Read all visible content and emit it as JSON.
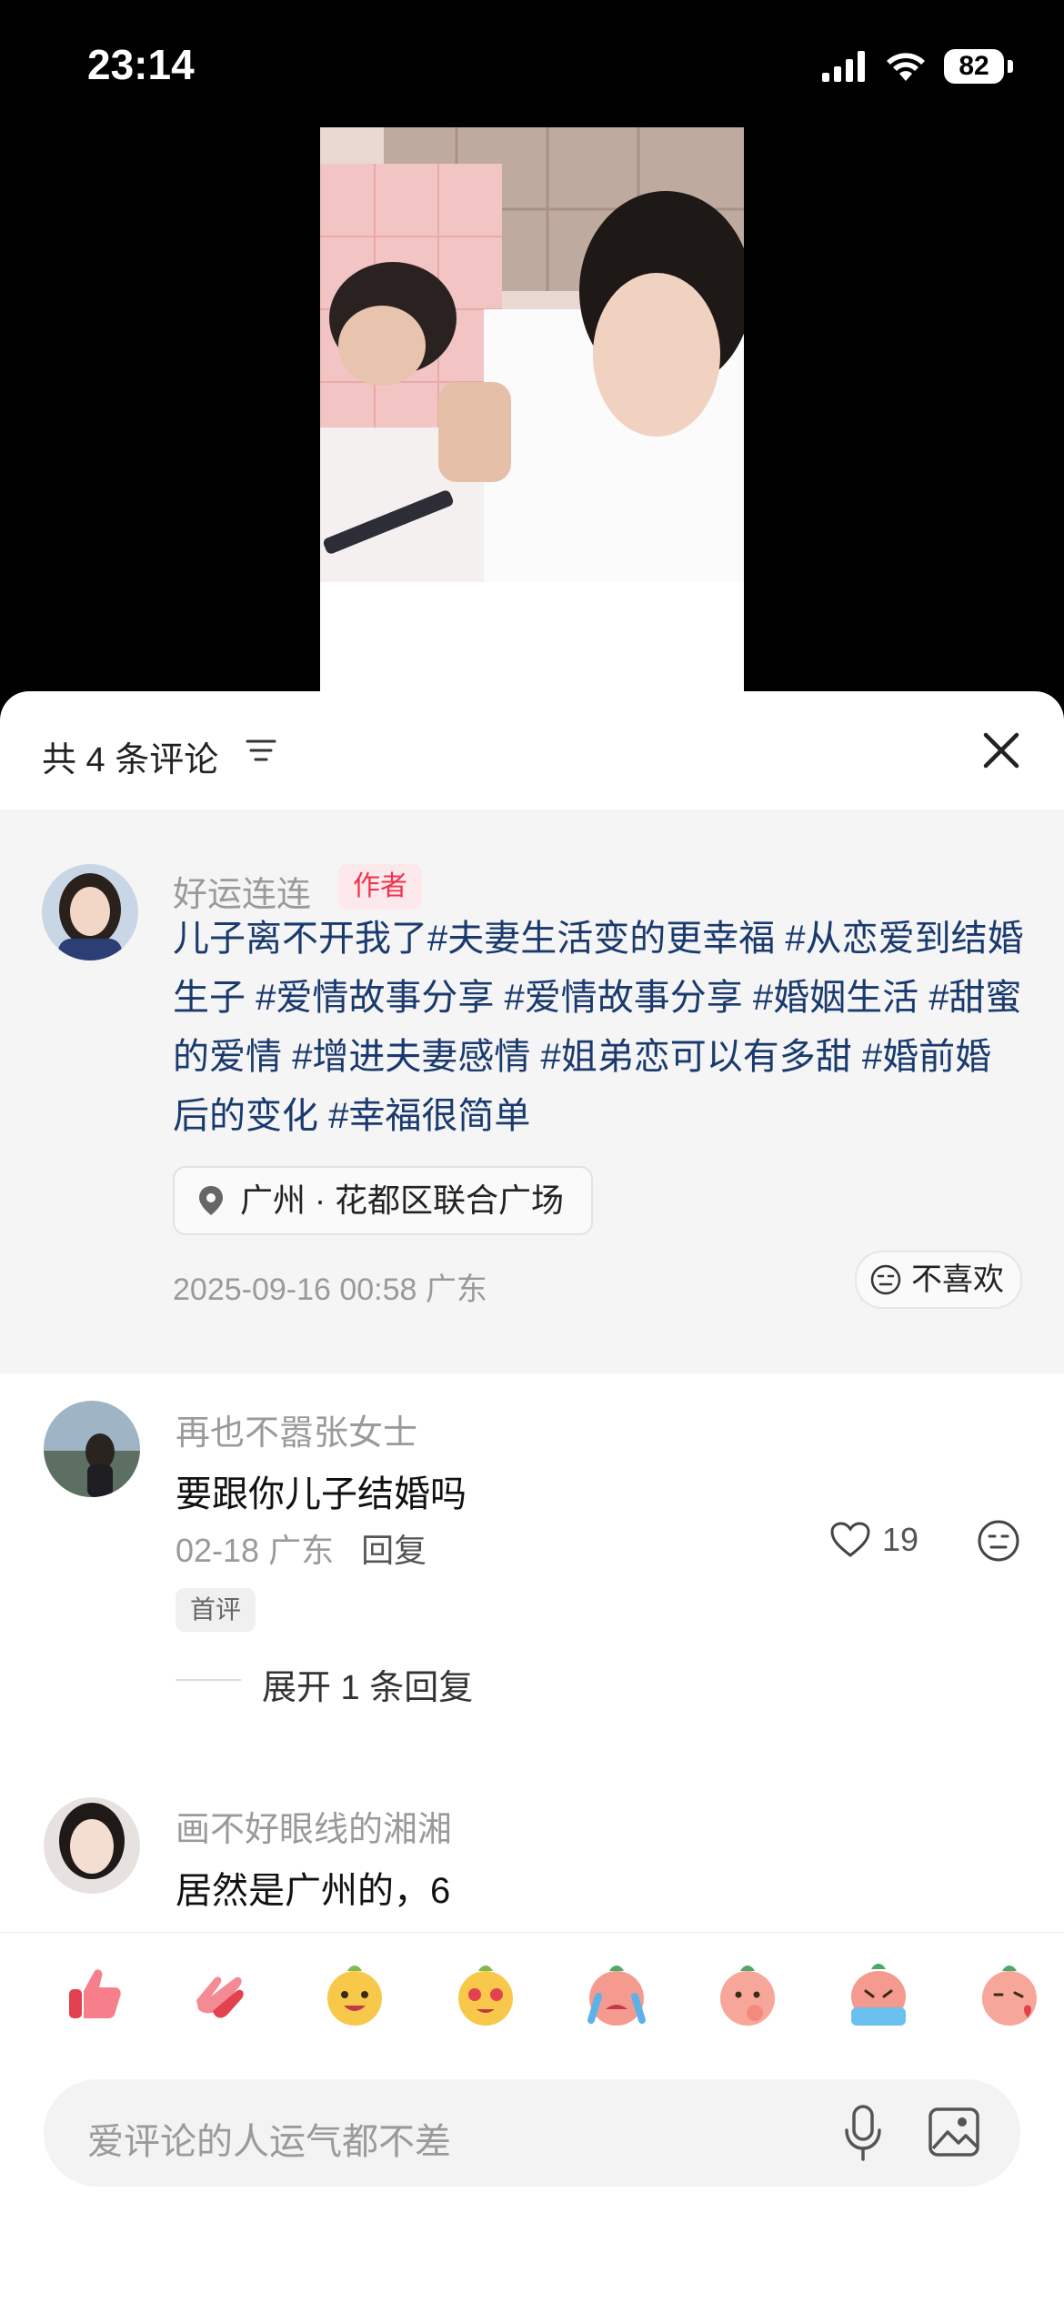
{
  "status_bar": {
    "time": "23:14",
    "battery": "82"
  },
  "comments_header": {
    "title": "共 4 条评论"
  },
  "author_post": {
    "username": "好运连连",
    "badge": "作者",
    "text": "儿子离不开我了#夫妻生活变的更幸福 #从恋爱到结婚生子 #爱情故事分享 #爱情故事分享 #婚姻生活 #甜蜜的爱情 #增进夫妻感情 #姐弟恋可以有多甜 #婚前婚后的变化 #幸福很简单",
    "location": "广州 · 花都区联合广场",
    "datetime_region": "2025-09-16 00:58 广东",
    "dislike_label": "不喜欢"
  },
  "comments": [
    {
      "username": "再也不嚣张女士",
      "text": "要跟你儿子结婚吗",
      "date_region": "02-18 广东",
      "reply_label": "回复",
      "likes": "19",
      "badge": "首评",
      "expand_label": "展开 1 条回复"
    },
    {
      "username": "画不好眼线的湘湘",
      "text": "居然是广州的，6"
    }
  ],
  "emoji_bar": [
    "thumbs-up",
    "clap",
    "grin-bean",
    "heart-eyes-bean",
    "crying-bean",
    "thinking-bean",
    "sobbing-bean",
    "kiss-bean"
  ],
  "input": {
    "placeholder": "爱评论的人运气都不差"
  },
  "colors": {
    "author_badge": "#f0334d",
    "hashtag": "#1a3a6e",
    "sheet_bg": "#ffffff",
    "author_block_bg": "#f5f5f5"
  }
}
